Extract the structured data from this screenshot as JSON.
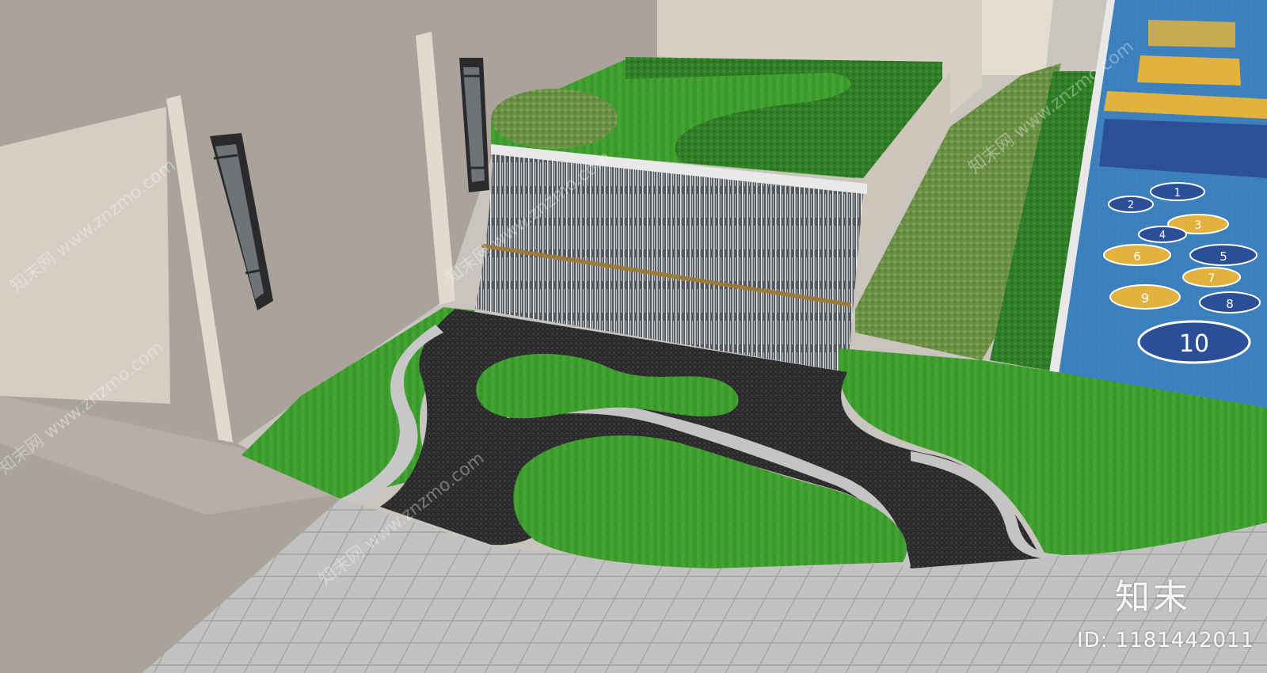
{
  "watermark": {
    "logo_text": "知末",
    "id_label": "ID:",
    "id_value": "1181442011",
    "repeated_text": "知末网 www.znzmo.com"
  },
  "court_numbers": [
    "1",
    "2",
    "3",
    "4",
    "5",
    "6",
    "7",
    "8",
    "9",
    "10"
  ],
  "colors": {
    "wall": "#cfc6bd",
    "wall_shadow": "#a79f98",
    "grass": "#3d9a2e",
    "hedge": "#2f7a24",
    "gravel": "#2e2e30",
    "pebble_edge": "#c9c9c9",
    "paving": "#bcbcbc",
    "court_blue": "#3a7fbf",
    "court_yellow": "#e2b43f",
    "waterfall": "#d8dde2"
  }
}
